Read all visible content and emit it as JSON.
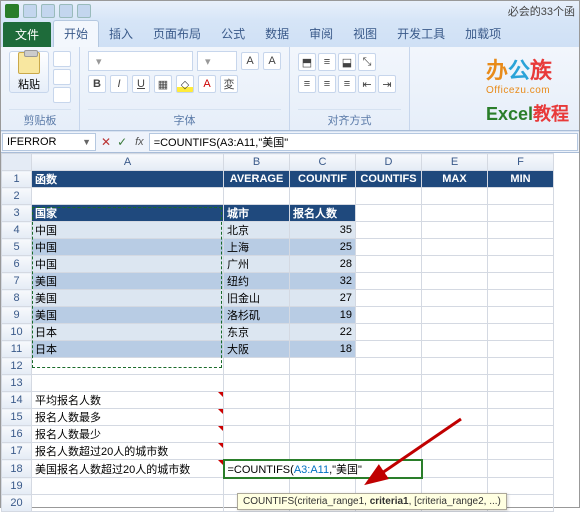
{
  "titlebar": {
    "right_text": "必会的33个函"
  },
  "ribbon_tabs": {
    "file": "文件",
    "home": "开始",
    "insert": "插入",
    "pagelayout": "页面布局",
    "formulas": "公式",
    "data": "数据",
    "review": "审阅",
    "view": "视图",
    "developer": "开发工具",
    "addins": "加载项"
  },
  "ribbon": {
    "paste": "粘贴",
    "group_clipboard": "剪贴板",
    "group_font": "字体",
    "group_align": "对齐方式"
  },
  "branding": {
    "logo1": "办",
    "logo2": "公",
    "logo3": "族",
    "sub": "Officezu.com",
    "excel": "Excel",
    "tutorial": "教程"
  },
  "formula_bar": {
    "name": "IFERROR",
    "formula": "=COUNTIFS(A3:A11,\"美国\""
  },
  "columns": [
    "A",
    "B",
    "C",
    "D",
    "E",
    "F"
  ],
  "rows": {
    "1": {
      "A": "函数",
      "B": "AVERAGE",
      "C": "COUNTIF",
      "D": "COUNTIFS",
      "E": "MAX",
      "F": "MIN"
    },
    "3": {
      "A": "国家",
      "B": "城市",
      "C": "报名人数"
    },
    "4": {
      "A": "中国",
      "B": "北京",
      "C": "35"
    },
    "5": {
      "A": "中国",
      "B": "上海",
      "C": "25"
    },
    "6": {
      "A": "中国",
      "B": "广州",
      "C": "28"
    },
    "7": {
      "A": "美国",
      "B": "纽约",
      "C": "32"
    },
    "8": {
      "A": "美国",
      "B": "旧金山",
      "C": "27"
    },
    "9": {
      "A": "美国",
      "B": "洛杉矶",
      "C": "19"
    },
    "10": {
      "A": "日本",
      "B": "东京",
      "C": "22"
    },
    "11": {
      "A": "日本",
      "B": "大阪",
      "C": "18"
    },
    "14": {
      "A": "平均报名人数"
    },
    "15": {
      "A": "报名人数最多"
    },
    "16": {
      "A": "报名人数最少"
    },
    "17": {
      "A": "报名人数超过20人的城市数"
    },
    "18": {
      "A": "美国报名人数超过20人的城市数",
      "B_formula": "=COUNTIFS(A3:A11,\"美国\""
    }
  },
  "tooltip": "COUNTIFS(criteria_range1, ",
  "tooltip_bold": "criteria1",
  "tooltip_end": ", [criteria_range2, ...)"
}
